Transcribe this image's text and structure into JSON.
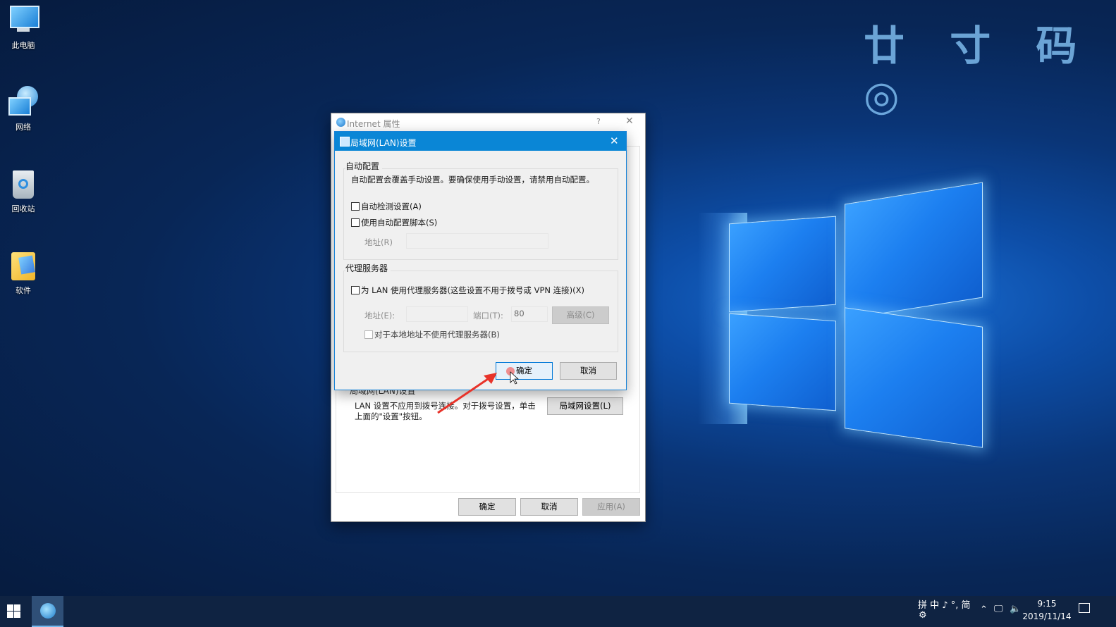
{
  "desktop": {
    "icons": [
      {
        "label": "此电脑"
      },
      {
        "label": "网络"
      },
      {
        "label": "回收站"
      },
      {
        "label": "软件"
      }
    ]
  },
  "outer_dialog": {
    "title": "Internet 属性",
    "help": "?",
    "close": "✕",
    "lan_group_label": "局域网(LAN)设置",
    "lan_desc": "LAN 设置不应用到拨号连接。对于拨号设置，单击上面的\"设置\"按钮。",
    "lan_settings_button": "局域网设置(L)",
    "ok": "确定",
    "cancel": "取消",
    "apply": "应用(A)"
  },
  "lan_dialog": {
    "title": "局域网(LAN)设置",
    "close": "✕",
    "auto_config": {
      "group_label": "自动配置",
      "description": "自动配置会覆盖手动设置。要确保使用手动设置，请禁用自动配置。",
      "auto_detect_label": "自动检测设置(A)",
      "auto_detect_checked": false,
      "use_script_label": "使用自动配置脚本(S)",
      "use_script_checked": false,
      "address_label": "地址(R)",
      "address_value": ""
    },
    "proxy": {
      "group_label": "代理服务器",
      "use_proxy_label": "为 LAN 使用代理服务器(这些设置不用于拨号或 VPN 连接)(X)",
      "use_proxy_checked": false,
      "address_label": "地址(E):",
      "address_value": "",
      "port_label": "端口(T):",
      "port_value": "80",
      "advanced_button": "高级(C)",
      "bypass_local_label": "对于本地地址不使用代理服务器(B)",
      "bypass_local_checked": false
    },
    "ok": "确定",
    "cancel": "取消"
  },
  "taskbar": {
    "ime": "拼 中 ♪ °, 简",
    "tray_icons": [
      "chevron-up-icon",
      "network-icon",
      "volume-icon"
    ],
    "time": "9:15",
    "date": "2019/11/14"
  },
  "watermark": "廿 寸 码 ◎",
  "colors": {
    "titlebar_accent": "#0a86d6",
    "taskbar": "#0f2342",
    "annotation_arrow": "#e8332a"
  }
}
